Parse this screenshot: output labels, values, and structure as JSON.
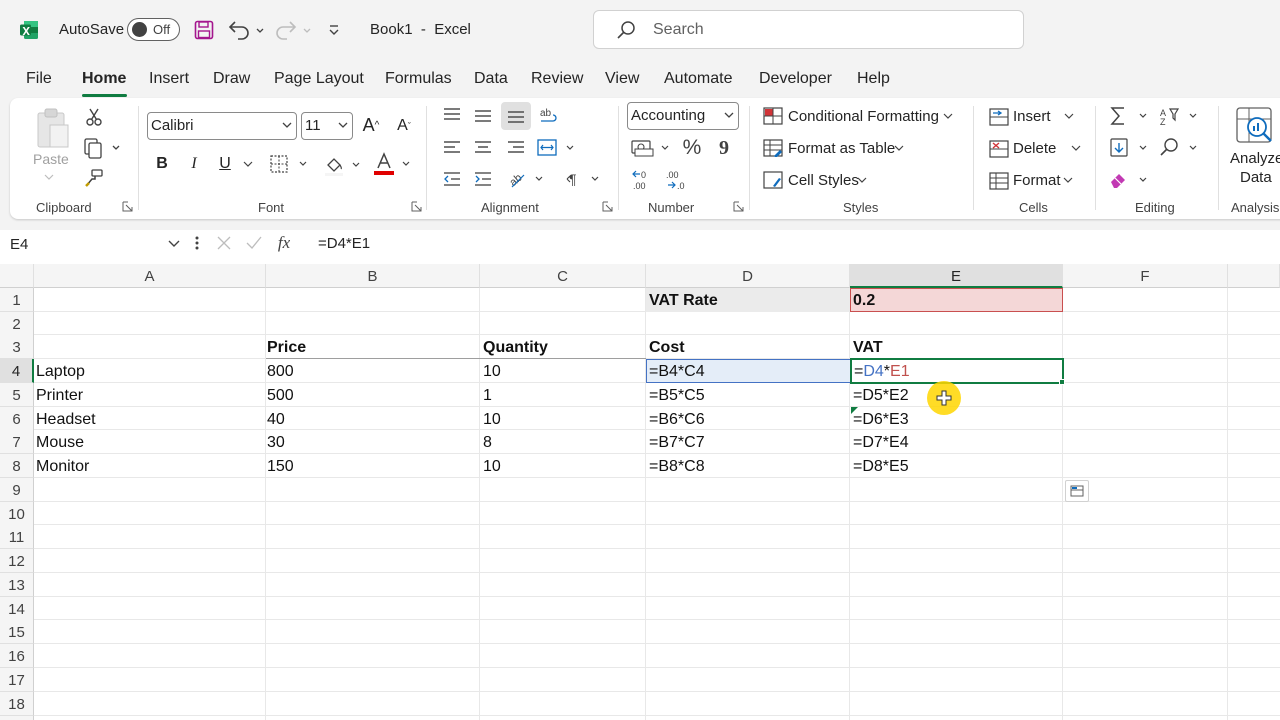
{
  "titlebar": {
    "autosave_label": "AutoSave",
    "autosave_state": "Off",
    "doc_title": "Book1  -  Excel",
    "search_placeholder": "Search",
    "accent_color": "#107c41"
  },
  "menu": {
    "tabs": [
      "File",
      "Home",
      "Insert",
      "Draw",
      "Page Layout",
      "Formulas",
      "Data",
      "Review",
      "View",
      "Automate",
      "Developer",
      "Help"
    ],
    "active": "Home"
  },
  "ribbon": {
    "clipboard": {
      "paste_label": "Paste",
      "group_label": "Clipboard"
    },
    "font": {
      "font_name": "Calibri",
      "font_size": "11",
      "group_label": "Font",
      "bold": "B",
      "italic": "I",
      "underline": "U"
    },
    "alignment": {
      "group_label": "Alignment"
    },
    "number": {
      "format": "Accounting",
      "percent": "%",
      "comma": "9",
      "group_label": "Number"
    },
    "styles": {
      "conditional": "Conditional Formatting",
      "format_table": "Format as Table",
      "cell_styles": "Cell Styles",
      "group_label": "Styles"
    },
    "cells": {
      "insert": "Insert",
      "delete": "Delete",
      "format": "Format",
      "group_label": "Cells"
    },
    "editing": {
      "group_label": "Editing"
    },
    "analysis": {
      "analyze_line1": "Analyze",
      "analyze_line2": "Data",
      "group_label": "Analysis"
    }
  },
  "formula_bar": {
    "name_box": "E4",
    "fx": "fx",
    "formula": "=D4*E1"
  },
  "sheet": {
    "columns": [
      "A",
      "B",
      "C",
      "D",
      "E",
      "F"
    ],
    "rows": [
      "1",
      "2",
      "3",
      "4",
      "5",
      "6",
      "7",
      "8",
      "9",
      "10",
      "11",
      "12",
      "13",
      "14",
      "15",
      "16",
      "17",
      "18"
    ],
    "d1": "VAT Rate",
    "e1": "0.2",
    "headers": {
      "price": "Price",
      "quantity": "Quantity",
      "cost": "Cost",
      "vat": "VAT"
    },
    "items": [
      {
        "name": "Laptop",
        "price": "800",
        "qty": "10",
        "cost": "=B4*C4"
      },
      {
        "name": "Printer",
        "price": "500",
        "qty": "1",
        "cost": "=B5*C5",
        "vat": "=D5*E2"
      },
      {
        "name": "Headset",
        "price": "40",
        "qty": "10",
        "cost": "=B6*C6",
        "vat": "=D6*E3"
      },
      {
        "name": "Mouse",
        "price": "30",
        "qty": "8",
        "cost": "=B7*C7",
        "vat": "=D7*E4"
      },
      {
        "name": "Monitor",
        "price": "150",
        "qty": "10",
        "cost": "=B8*C8",
        "vat": "=D8*E5"
      }
    ],
    "e4_edit": {
      "eq": "=",
      "ref1": "D4",
      "op": "*",
      "ref2": "E1"
    },
    "ref_colors": {
      "ref1": "#4472c4",
      "ref2": "#c0504d"
    }
  }
}
